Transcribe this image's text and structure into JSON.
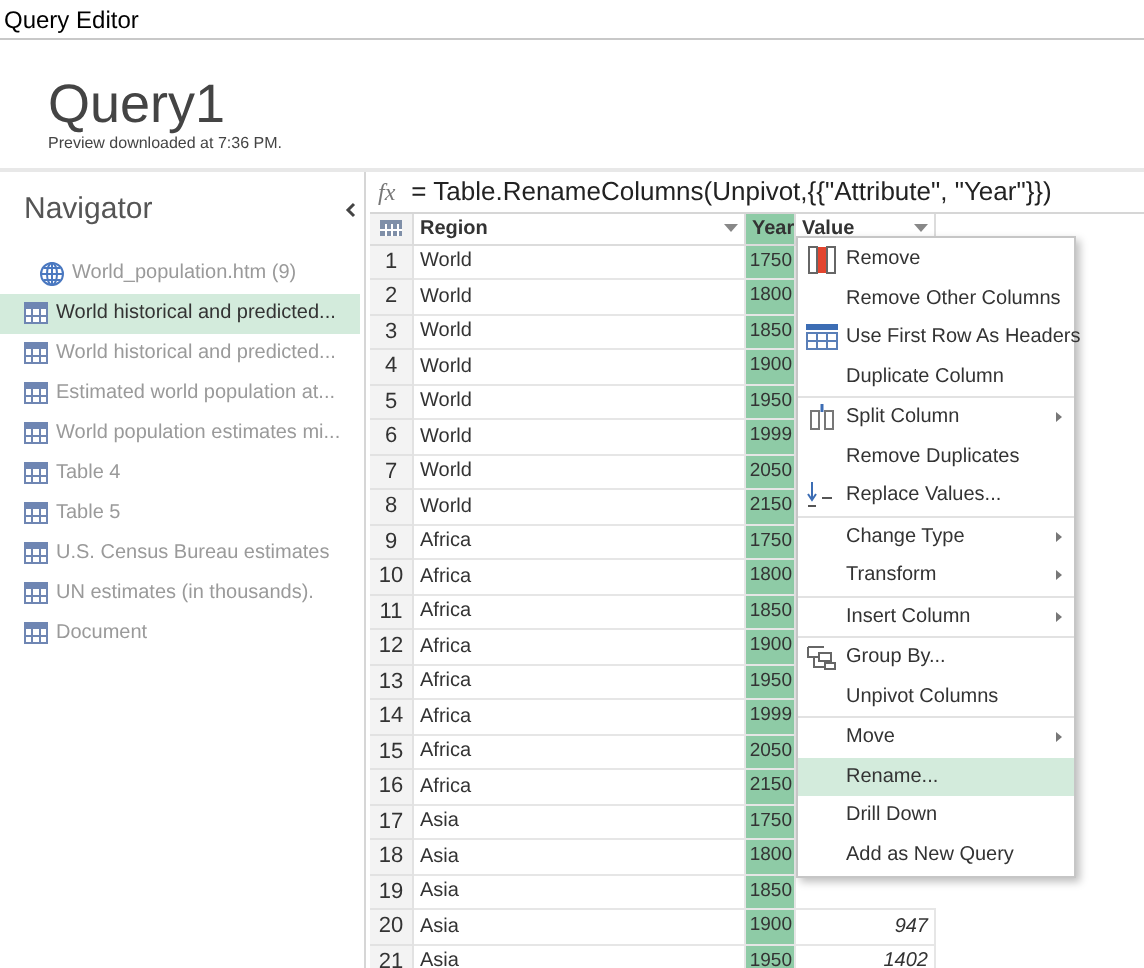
{
  "window": {
    "title": "Query Editor"
  },
  "query": {
    "name": "Query1",
    "subtitle": "Preview downloaded at 7:36 PM."
  },
  "navigator": {
    "title": "Navigator",
    "items": [
      {
        "label": "World_population.htm (9)",
        "selected": false,
        "children": [
          {
            "label": "World historical and predicted...",
            "selected": true
          },
          {
            "label": "World historical and predicted...",
            "selected": false
          },
          {
            "label": "Estimated world population at...",
            "selected": false
          },
          {
            "label": "World population estimates mi...",
            "selected": false
          },
          {
            "label": "Table 4",
            "selected": false
          },
          {
            "label": "Table 5",
            "selected": false
          },
          {
            "label": "U.S. Census Bureau estimates",
            "selected": false
          },
          {
            "label": "UN estimates (in thousands).",
            "selected": false
          },
          {
            "label": "Document",
            "selected": false
          }
        ]
      }
    ]
  },
  "formula_icon": "fx",
  "formula": "= Table.RenameColumns(Unpivot,{{\"Attribute\", \"Year\"}})",
  "table": {
    "columns": [
      {
        "name": "Region",
        "selected": false
      },
      {
        "name": "Year",
        "selected": true
      },
      {
        "name": "Value",
        "selected": false
      }
    ],
    "rows": [
      {
        "n": "1",
        "region": "World",
        "year": "1750"
      },
      {
        "n": "2",
        "region": "World",
        "year": "1800"
      },
      {
        "n": "3",
        "region": "World",
        "year": "1850"
      },
      {
        "n": "4",
        "region": "World",
        "year": "1900"
      },
      {
        "n": "5",
        "region": "World",
        "year": "1950"
      },
      {
        "n": "6",
        "region": "World",
        "year": "1999"
      },
      {
        "n": "7",
        "region": "World",
        "year": "2050"
      },
      {
        "n": "8",
        "region": "World",
        "year": "2150"
      },
      {
        "n": "9",
        "region": "Africa",
        "year": "1750"
      },
      {
        "n": "10",
        "region": "Africa",
        "year": "1800"
      },
      {
        "n": "11",
        "region": "Africa",
        "year": "1850"
      },
      {
        "n": "12",
        "region": "Africa",
        "year": "1900"
      },
      {
        "n": "13",
        "region": "Africa",
        "year": "1950"
      },
      {
        "n": "14",
        "region": "Africa",
        "year": "1999"
      },
      {
        "n": "15",
        "region": "Africa",
        "year": "2050"
      },
      {
        "n": "16",
        "region": "Africa",
        "year": "2150"
      },
      {
        "n": "17",
        "region": "Asia",
        "year": "1750"
      },
      {
        "n": "18",
        "region": "Asia",
        "year": "1800"
      },
      {
        "n": "19",
        "region": "Asia",
        "year": "1850"
      },
      {
        "n": "20",
        "region": "Asia",
        "year": "1900",
        "value": "947"
      },
      {
        "n": "21",
        "region": "Asia",
        "year": "1950",
        "value": "1402"
      }
    ]
  },
  "context_menu": {
    "groups": [
      [
        {
          "label": "Remove",
          "submenu": false,
          "selected": false
        },
        {
          "label": "Remove Other Columns",
          "submenu": false,
          "selected": false
        },
        {
          "label": "Use First Row As Headers",
          "submenu": false,
          "selected": false
        },
        {
          "label": "Duplicate Column",
          "submenu": false,
          "selected": false
        }
      ],
      [
        {
          "label": "Split Column",
          "submenu": true,
          "selected": false
        },
        {
          "label": "Remove Duplicates",
          "submenu": false,
          "selected": false
        },
        {
          "label": "Replace Values...",
          "submenu": false,
          "selected": false
        }
      ],
      [
        {
          "label": "Change Type",
          "submenu": true,
          "selected": false
        },
        {
          "label": "Transform",
          "submenu": true,
          "selected": false
        }
      ],
      [
        {
          "label": "Insert Column",
          "submenu": true,
          "selected": false
        }
      ],
      [
        {
          "label": "Group By...",
          "submenu": false,
          "selected": false
        },
        {
          "label": "Unpivot Columns",
          "submenu": false,
          "selected": false
        }
      ],
      [
        {
          "label": "Move",
          "submenu": true,
          "selected": false
        },
        {
          "label": "Rename...",
          "submenu": false,
          "selected": true
        },
        {
          "label": "Drill Down",
          "submenu": false,
          "selected": false
        },
        {
          "label": "Add as New Query",
          "submenu": false,
          "selected": false
        }
      ]
    ]
  }
}
